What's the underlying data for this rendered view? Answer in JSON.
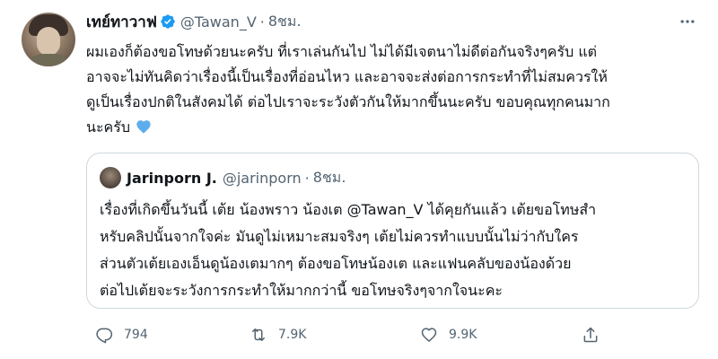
{
  "tweet": {
    "display_name": "เทย์ทาวาฟ",
    "handle": "@Tawan_V",
    "separator": "·",
    "time": "8ชม.",
    "text_lines": [
      "ผมเองก็ต้องขอโทษด้วยนะครับ ที่เราเล่นกันไป ไม่ได้มีเจตนาไม่ดีต่อกันจริงๆครับ แต่",
      "อาจจะไม่ทันคิดว่าเรื่องนี้เป็นเรื่องที่อ่อนไหว และอาจจะส่งต่อการกระทำที่ไม่สมควรให้",
      "ดูเป็นเรื่องปกติในสังคมได้ ต่อไปเราจะระวังตัวกันให้มากขึ้นนะครับ ขอบคุณทุกคนมาก",
      "นะครับ"
    ],
    "heart_emoji_icon": "blue-heart-icon",
    "verified_color": "#1d9bf0",
    "accent_color": "#1d9bf0"
  },
  "quoted": {
    "display_name": "Jarinporn J.",
    "handle": "@jarinporn",
    "separator": "·",
    "time": "8ชม.",
    "text_lines": [
      "เรื่องที่เกิดขึ้นวันนี้ เต้ย น้องพราว น้องเต @Tawan_V ได้คุยกันแล้ว เต้ยขอโทษสำ",
      "หรับคลิปนั้นจากใจค่ะ มันดูไม่เหมาะสมจริงๆ เต้ยไม่ควรทำแบบนั้นไม่ว่ากับใคร",
      "ส่วนตัวเต้ยเองเอ็นดูน้องเตมากๆ ต้องขอโทษน้องเต และแฟนคลับของน้องด้วย",
      "ต่อไปเต้ยจะระวังการกระทำให้มากกว่านี้ ขอโทษจริงๆจากใจนะคะ"
    ]
  },
  "actions": {
    "reply_count": "794",
    "retweet_count": "7.9K",
    "like_count": "9.9K"
  },
  "icons": {
    "more": "more-dots-icon",
    "reply": "reply-icon",
    "retweet": "retweet-icon",
    "like": "heart-icon",
    "share": "share-icon",
    "verified": "verified-badge-icon"
  }
}
